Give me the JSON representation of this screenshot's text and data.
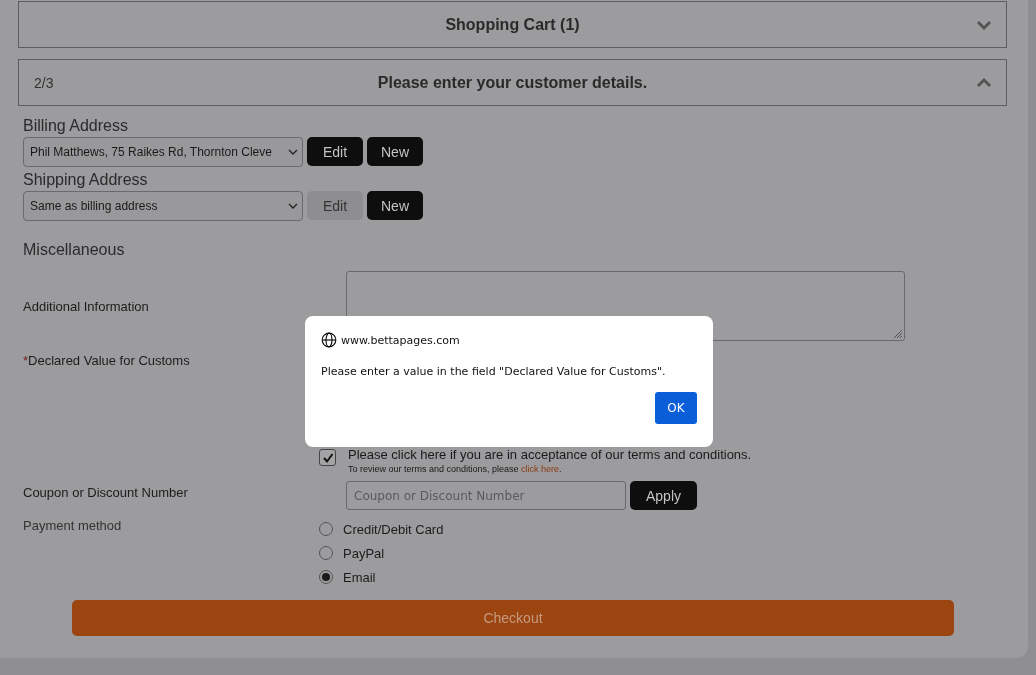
{
  "accordion": [
    {
      "title": "Shopping Cart (1)",
      "expanded": false
    },
    {
      "title": "Please enter your customer details.",
      "step": "2/3",
      "expanded": true
    }
  ],
  "billing": {
    "label": "Billing Address",
    "value": "Phil Matthews, 75 Raikes Rd, Thornton Cleve",
    "buttons": [
      {
        "label": "Edit",
        "disabled": false
      },
      {
        "label": "New",
        "disabled": false
      }
    ]
  },
  "shipping": {
    "label": "Shipping Address",
    "value": "Same as billing address",
    "buttons": [
      {
        "label": "Edit",
        "disabled": true
      },
      {
        "label": "New",
        "disabled": false
      }
    ]
  },
  "misc": {
    "heading": "Miscellaneous",
    "additional_label": "Additional Information",
    "declared_required_mark": "*",
    "declared_label": "Declared Value for Customs"
  },
  "terms": {
    "checked": true,
    "text": "Please click here if you are in acceptance of our terms and conditions.",
    "review_text": "To review our terms and conditions, please ",
    "review_link": "click here",
    "review_end": "."
  },
  "coupon": {
    "label": "Coupon or Discount Number",
    "placeholder": "Coupon or Discount Number",
    "button": "Apply"
  },
  "payment": {
    "label": "Payment method",
    "options": [
      {
        "label": "Credit/Debit Card",
        "selected": false
      },
      {
        "label": "PayPal",
        "selected": false
      },
      {
        "label": "Email",
        "selected": true
      }
    ]
  },
  "checkout": "Checkout",
  "dialog": {
    "origin": "www.bettapages.com",
    "message": "Please enter a value in the field \"Declared Value for Customs\".",
    "button": "OK"
  }
}
